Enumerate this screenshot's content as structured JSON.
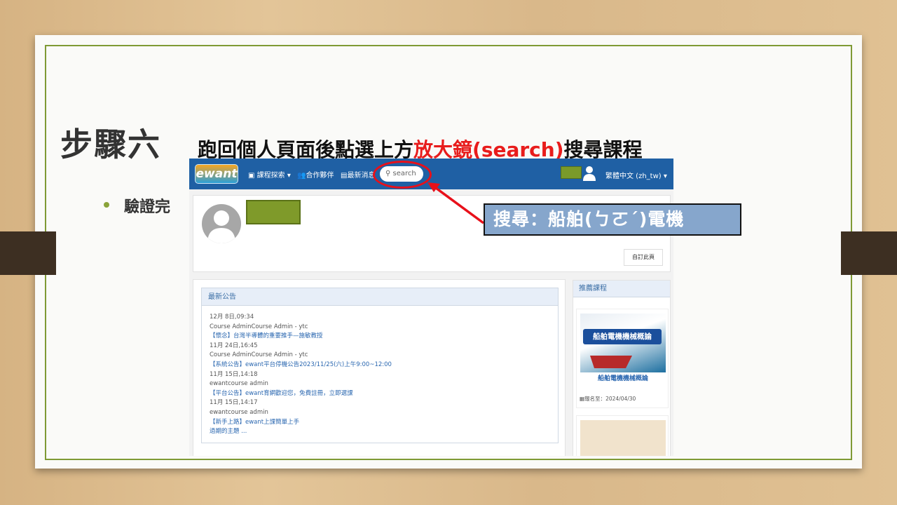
{
  "slide": {
    "step_title": "步驟六",
    "instruction_prefix": "跑回個人頁面後點選上方",
    "instruction_highlight": "放大鏡(search)",
    "instruction_suffix": "搜尋課程",
    "bullet": "驗證完"
  },
  "callout": {
    "text": "搜尋：船舶(ㄅㄛˊ)電機"
  },
  "nav": {
    "logo": "ewant",
    "items": [
      "課程探索 ▾",
      "合作夥伴",
      "最新消息"
    ],
    "search_placeholder": "search",
    "language": "繁體中文 (zh_tw) ▾"
  },
  "profile": {
    "customize_button": "自訂此頁"
  },
  "announcements": {
    "title": "最新公告",
    "lines": [
      {
        "text": "12月 8日,09:34",
        "link": false
      },
      {
        "text": "Course AdminCourse Admin - ytc",
        "link": false
      },
      {
        "text": "【懷念】台灣半導體的重要推手—施敏教授",
        "link": true
      },
      {
        "text": "11月 24日,16:45",
        "link": false
      },
      {
        "text": "Course AdminCourse Admin - ytc",
        "link": false
      },
      {
        "text": "【系統公告】ewant平台停機公告2023/11/25(六)上午9:00~12:00",
        "link": true
      },
      {
        "text": "11月 15日,14:18",
        "link": false
      },
      {
        "text": "ewantcourse admin",
        "link": false
      },
      {
        "text": "【平台公告】ewant育網歡迎您，免費註冊，立即選課",
        "link": true
      },
      {
        "text": "11月 15日,14:17",
        "link": false
      },
      {
        "text": "ewantcourse admin",
        "link": false
      },
      {
        "text": "【新手上路】ewant上課簡單上手",
        "link": true
      },
      {
        "text": "過期的主題 ...",
        "link": true
      }
    ]
  },
  "recommended": {
    "title": "推薦課程",
    "course1": {
      "image_title": "船舶電機機械概論",
      "title": "船舶電機機械概論",
      "date": "報名至：2024/04/30"
    }
  },
  "colors": {
    "nav": "#1f60a4",
    "highlight": "#e81c1c",
    "callout": "#86a6cc",
    "frame": "#7f9a35"
  }
}
